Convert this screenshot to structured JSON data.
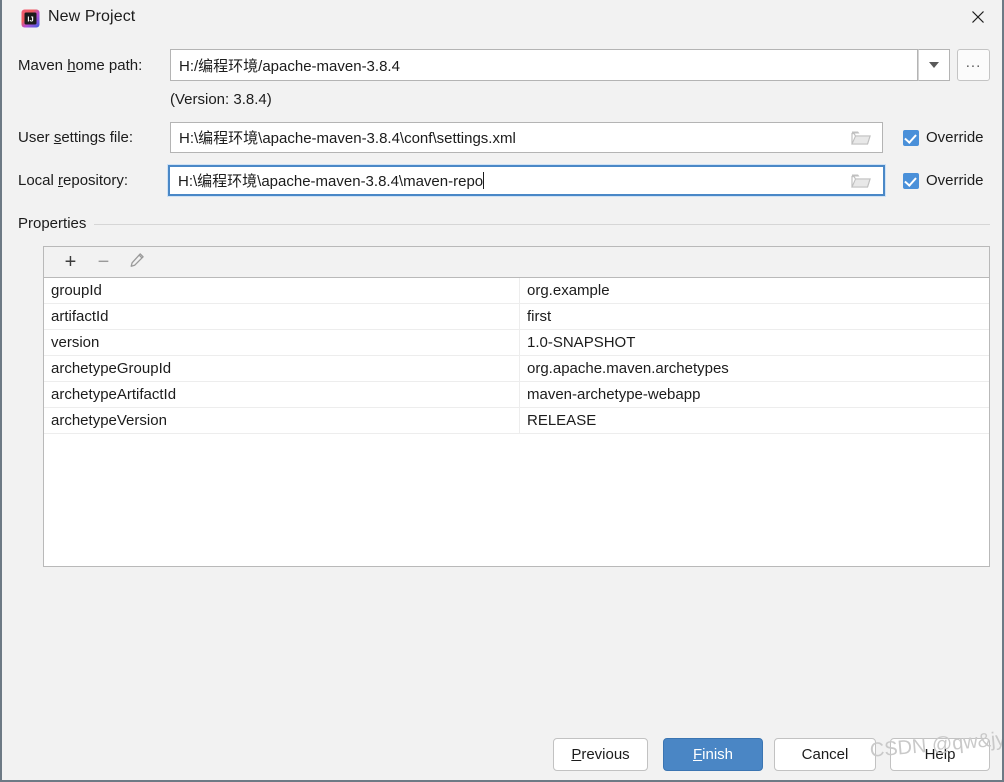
{
  "window": {
    "title": "New Project",
    "app_icon": "intellij-idea-icon",
    "close_icon": "close-icon"
  },
  "form": {
    "maven_home": {
      "label_prefix": "Maven ",
      "label_mnemonic": "h",
      "label_suffix": "ome path:",
      "label_full": "Maven home path:",
      "value": "H:/编程环境/apache-maven-3.8.4",
      "dropdown_icon": "chevron-down-icon",
      "browse_label": "...",
      "version_note": "(Version: 3.8.4)"
    },
    "user_settings": {
      "label_prefix": "User ",
      "label_mnemonic": "s",
      "label_suffix": "ettings file:",
      "label_full": "User settings file:",
      "value": "H:\\编程环境\\apache-maven-3.8.4\\conf\\settings.xml",
      "folder_icon": "folder-icon",
      "override_label": "Override",
      "override_checked": true
    },
    "local_repository": {
      "label_prefix": "Local ",
      "label_mnemonic": "r",
      "label_suffix": "epository:",
      "label_full": "Local repository:",
      "value": "H:\\编程环境\\apache-maven-3.8.4\\maven-repo",
      "focused": true,
      "folder_icon": "folder-icon",
      "override_label": "Override",
      "override_checked": true
    }
  },
  "properties": {
    "group_label": "Properties",
    "toolbar": {
      "add_label": "+",
      "remove_label": "−",
      "edit_icon": "pencil-icon"
    },
    "rows": [
      {
        "key": "groupId",
        "value": "org.example"
      },
      {
        "key": "artifactId",
        "value": "first"
      },
      {
        "key": "version",
        "value": "1.0-SNAPSHOT"
      },
      {
        "key": "archetypeGroupId",
        "value": "org.apache.maven.archetypes"
      },
      {
        "key": "archetypeArtifactId",
        "value": "maven-archetype-webapp"
      },
      {
        "key": "archetypeVersion",
        "value": "RELEASE"
      }
    ]
  },
  "footer": {
    "previous": {
      "prefix": "",
      "mnemonic": "P",
      "suffix": "revious",
      "full": "Previous"
    },
    "finish": {
      "prefix": "",
      "mnemonic": "F",
      "suffix": "inish",
      "full": "Finish"
    },
    "cancel": {
      "full": "Cancel"
    },
    "help": {
      "full": "Help"
    }
  },
  "watermark": "CSDN @qw&jy",
  "colors": {
    "accent_blue": "#4a86c5",
    "checkbox_blue": "#4a90d9",
    "focus_border": "#4a88c7",
    "window_bg": "#f2f2f2",
    "field_bg": "#ffffff",
    "text": "#1c1c1c"
  }
}
